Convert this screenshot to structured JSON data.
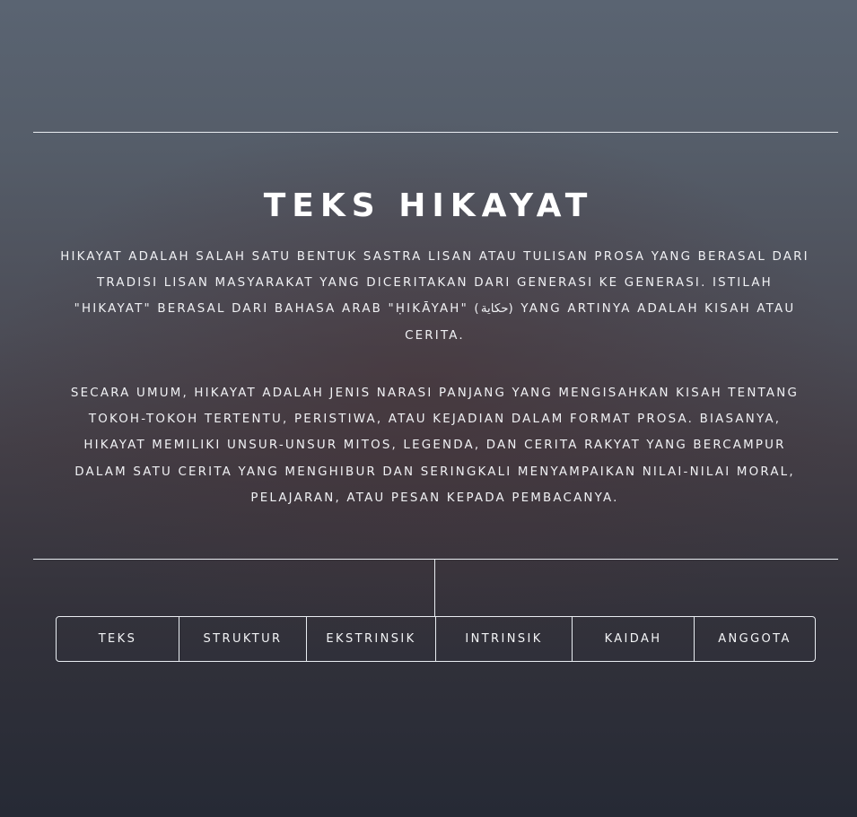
{
  "header": {
    "title": "TEKS HIKAYAT"
  },
  "content": {
    "paragraph_1": "HIKAYAT ADALAH SALAH SATU BENTUK SASTRA LISAN ATAU TULISAN PROSA YANG BERASAL DARI TRADISI LISAN MASYARAKAT YANG DICERITAKAN DARI GENERASI KE GENERASI. ISTILAH \"HIKAYAT\" BERASAL DARI BAHASA ARAB \"ḤIKĀYAH\" (حكاية) YANG ARTINYA ADALAH KISAH ATAU CERITA.",
    "paragraph_2": "SECARA UMUM, HIKAYAT ADALAH JENIS NARASI PANJANG YANG MENGISAHKAN KISAH TENTANG TOKOH-TOKOH TERTENTU, PERISTIWA, ATAU KEJADIAN DALAM FORMAT PROSA. BIASANYA, HIKAYAT MEMILIKI UNSUR-UNSUR MITOS, LEGENDA, DAN CERITA RAKYAT YANG BERCAMPUR DALAM SATU CERITA YANG MENGHIBUR DAN SERINGKALI MENYAMPAIKAN NILAI-NILAI MORAL, PELAJARAN, ATAU PESAN KEPADA PEMBACANYA."
  },
  "nav": {
    "items": [
      {
        "label": "TEKS"
      },
      {
        "label": "STRUKTUR"
      },
      {
        "label": "EKSTRINSIK"
      },
      {
        "label": "INTRINSIK"
      },
      {
        "label": "KAIDAH"
      },
      {
        "label": "ANGGOTA"
      }
    ]
  }
}
